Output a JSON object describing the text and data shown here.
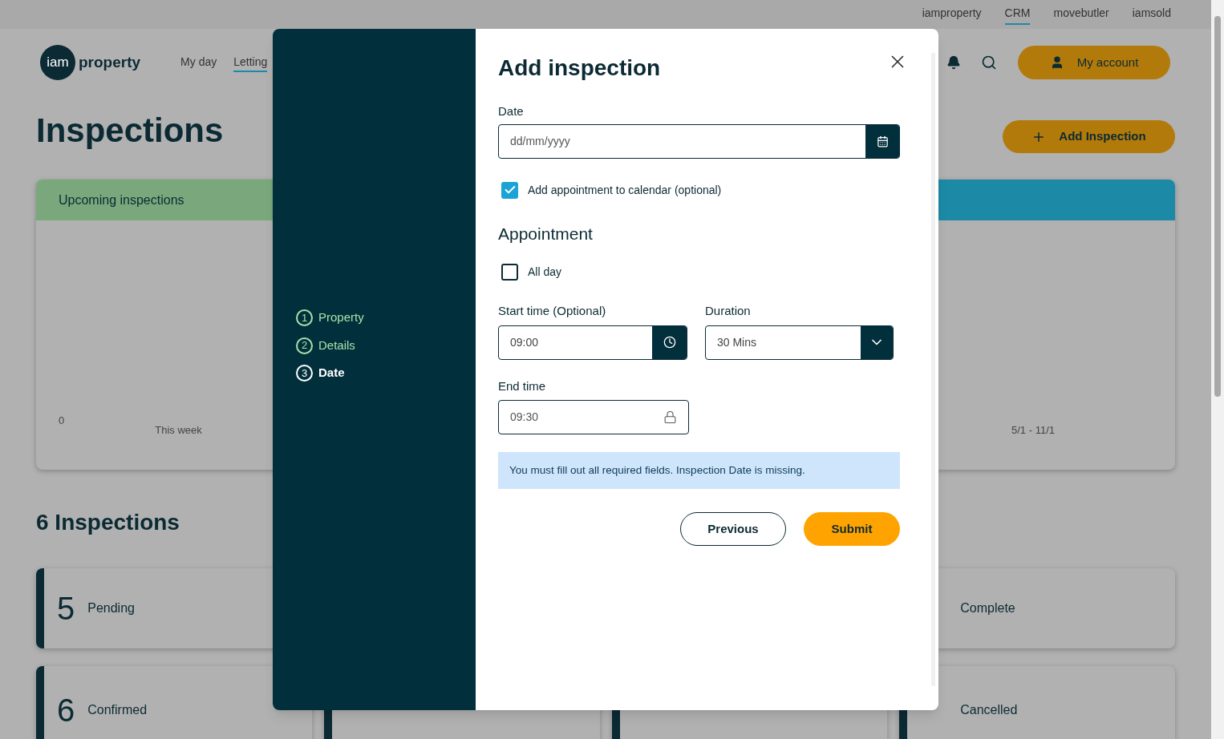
{
  "top_links": [
    {
      "label": "iamproperty",
      "selected": false
    },
    {
      "label": "CRM",
      "selected": true
    },
    {
      "label": "movebutler",
      "selected": false
    },
    {
      "label": "iamsold",
      "selected": false
    }
  ],
  "logo": {
    "badge": "iam",
    "text": "property"
  },
  "nav": [
    {
      "label": "My day",
      "selected": false
    },
    {
      "label": "Letting",
      "selected": true
    }
  ],
  "account_button": "My account",
  "page_title": "Inspections",
  "add_button": "Add Inspection",
  "chart_cards": [
    {
      "title": "Upcoming inspections",
      "color": "#7aa87c",
      "axis_label": "0",
      "period": "This week"
    },
    {
      "color": "#1c8aa6",
      "period": "5/1 - 11/1"
    }
  ],
  "count_heading": "6 Inspections",
  "status_cards": [
    {
      "count": "5",
      "label": "Pending"
    },
    {
      "label": "Complete"
    }
  ],
  "status_cards_row2": [
    {
      "count": "6",
      "label": "Confirmed"
    },
    {
      "label": "Cancelled"
    }
  ],
  "modal": {
    "steps": [
      {
        "number": "1",
        "label": "Property",
        "selected": false
      },
      {
        "number": "2",
        "label": "Details",
        "selected": false
      },
      {
        "number": "3",
        "label": "Date",
        "selected": true
      }
    ],
    "title": "Add inspection",
    "date_label": "Date",
    "date_placeholder": "dd/mm/yyyy",
    "calendar_option": {
      "label": "Add appointment to calendar (optional)",
      "checked": true
    },
    "section_heading": "Appointment",
    "all_day": {
      "label": "All day",
      "checked": false
    },
    "start_label": "Start time (Optional)",
    "start_value": "09:00",
    "duration_label": "Duration",
    "duration_value": "30 Mins",
    "end_label": "End time",
    "end_value": "09:30",
    "end_disabled": true,
    "alert": "You must fill out all required fields. Inspection Date is missing.",
    "buttons": [
      {
        "label": "Previous",
        "kind": "secondary"
      },
      {
        "label": "Submit",
        "kind": "primary"
      }
    ]
  }
}
